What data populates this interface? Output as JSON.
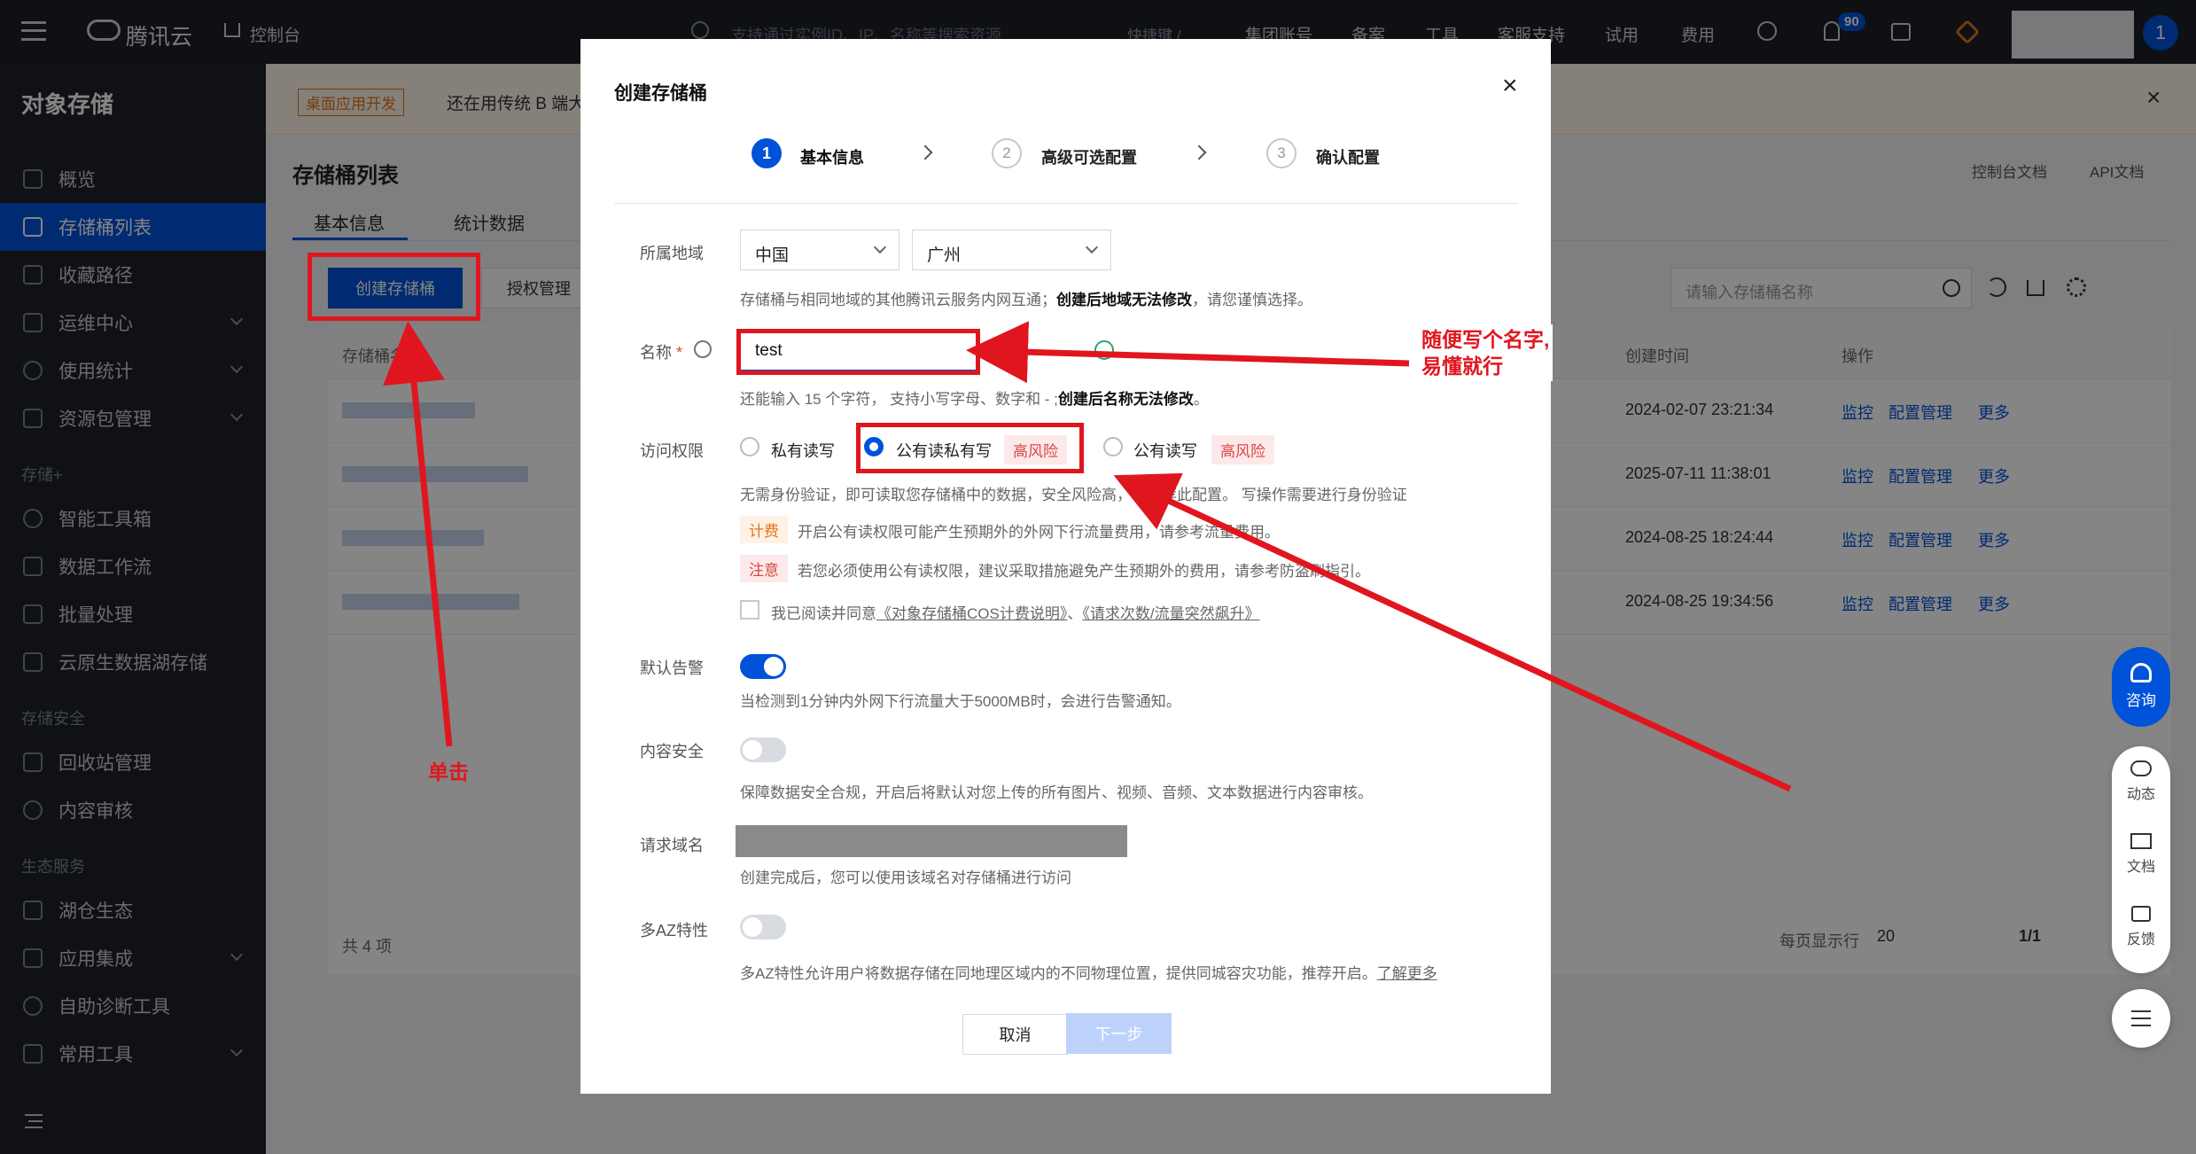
{
  "topbar": {
    "brand": "腾讯云",
    "console": "控制台",
    "search_placeholder": "支持通过实例ID、IP、名称等搜索资源",
    "shortcut": "快捷键 /",
    "menu": [
      "集团账号",
      "备案",
      "工具",
      "客服支持",
      "试用",
      "费用"
    ],
    "notification_count": "90",
    "avatar_label": "1"
  },
  "sidebar": {
    "title": "对象存储",
    "items": [
      {
        "label": "概览",
        "active": false,
        "expandable": false
      },
      {
        "label": "存储桶列表",
        "active": true,
        "expandable": false
      },
      {
        "label": "收藏路径",
        "active": false,
        "expandable": false
      },
      {
        "label": "运维中心",
        "active": false,
        "expandable": true
      },
      {
        "label": "使用统计",
        "active": false,
        "expandable": true
      },
      {
        "label": "资源包管理",
        "active": false,
        "expandable": true
      }
    ],
    "group_storage_plus": "存储+",
    "items2": [
      "智能工具箱",
      "数据工作流",
      "批量处理",
      "云原生数据湖存储"
    ],
    "group_security": "存储安全",
    "items3": [
      "回收站管理",
      "内容审核"
    ],
    "group_eco": "生态服务",
    "items4": [
      {
        "label": "湖仓生态",
        "expandable": false
      },
      {
        "label": "应用集成",
        "expandable": true
      },
      {
        "label": "自助诊断工具",
        "expandable": false
      },
      {
        "label": "常用工具",
        "expandable": true
      }
    ]
  },
  "banner": {
    "tag": "桌面应用开发",
    "text": "还在用传统 B 端大"
  },
  "page": {
    "title": "存储桶列表",
    "tabs": [
      "基本信息",
      "统计数据"
    ],
    "create_button": "创建存储桶",
    "auth_button": "授权管理",
    "search_placeholder": "请输入存储桶名称",
    "doc_links": [
      "控制台文档",
      "API文档"
    ],
    "columns": [
      "存储桶名称",
      "创建时间",
      "操作"
    ],
    "rows": [
      {
        "created": "2024-02-07 23:21:34"
      },
      {
        "created": "2025-07-11 11:38:01"
      },
      {
        "created": "2024-08-25 18:24:44"
      },
      {
        "created": "2024-08-25 19:34:56"
      }
    ],
    "row_actions": [
      "监控",
      "配置管理",
      "更多"
    ],
    "total": "共 4 项",
    "per_page_label": "每页显示行",
    "per_page_value": "20",
    "page_indicator": "1/1"
  },
  "modal": {
    "title": "创建存储桶",
    "steps": [
      {
        "num": "1",
        "label": "基本信息",
        "active": true
      },
      {
        "num": "2",
        "label": "高级可选配置",
        "active": false
      },
      {
        "num": "3",
        "label": "确认配置",
        "active": false
      }
    ],
    "region_label": "所属地域",
    "region_country": "中国",
    "region_city": "广州",
    "region_hint_pre": "存储桶与相同地域的其他腾讯云服务内网互通；",
    "region_hint_bold": "创建后地域无法修改",
    "region_hint_post": "，请您谨慎选择。",
    "name_label": "名称",
    "name_required": "*",
    "name_value": "test",
    "name_hint_pre": "还能输入 15 个字符， 支持小写字母、数字和 - ;",
    "name_hint_bold": "创建后名称无法修改",
    "name_hint_post": "。",
    "access_label": "访问权限",
    "access_options": [
      "私有读写",
      "公有读私有写",
      "公有读写"
    ],
    "risk_tag": "高风险",
    "access_desc": "无需身份验证，即可读取您存储桶中的数据，安全风险高，不推荐此配置。 写操作需要进行身份验证",
    "billing_tag": "计费",
    "billing_text": "开启公有读权限可能产生预期外的外网下行流量费用，请参考流量费用。",
    "notice_tag": "注意",
    "notice_text": "若您必须使用公有读权限，建议采取措施避免产生预期外的费用，请参考防盗刷指引。",
    "agree_text": "我已阅读并同意",
    "agree_link1": "《对象存储桶COS计费说明》",
    "agree_sep": "、",
    "agree_link2": "《请求次数/流量突然飙升》",
    "alarm_label": "默认告警",
    "alarm_desc": "当检测到1分钟内外网下行流量大于5000MB时，会进行告警通知。",
    "content_label": "内容安全",
    "content_desc": "保障数据安全合规，开启后将默认对您上传的所有图片、视频、音频、文本数据进行内容审核。",
    "domain_label": "请求域名",
    "domain_desc": "创建完成后，您可以使用该域名对存储桶进行访问",
    "maz_label": "多AZ特性",
    "maz_desc": "多AZ特性允许用户将数据存储在同地理区域内的不同物理位置，提供同城容灾功能，推荐开启。",
    "maz_link": "了解更多",
    "cancel": "取消",
    "next": "下一步"
  },
  "annotations": {
    "click_note": "单击",
    "name_note_line1": "随便写个名字,",
    "name_note_line2": "易懂就行"
  },
  "float_buttons": {
    "consult": "咨询",
    "dynamic": "动态",
    "docs": "文档",
    "feedback": "反馈"
  },
  "colors": {
    "brand_blue": "#0052d9",
    "annotation_red": "#e0161f",
    "risk_red": "#d54941",
    "billing_orange": "#e37318"
  }
}
